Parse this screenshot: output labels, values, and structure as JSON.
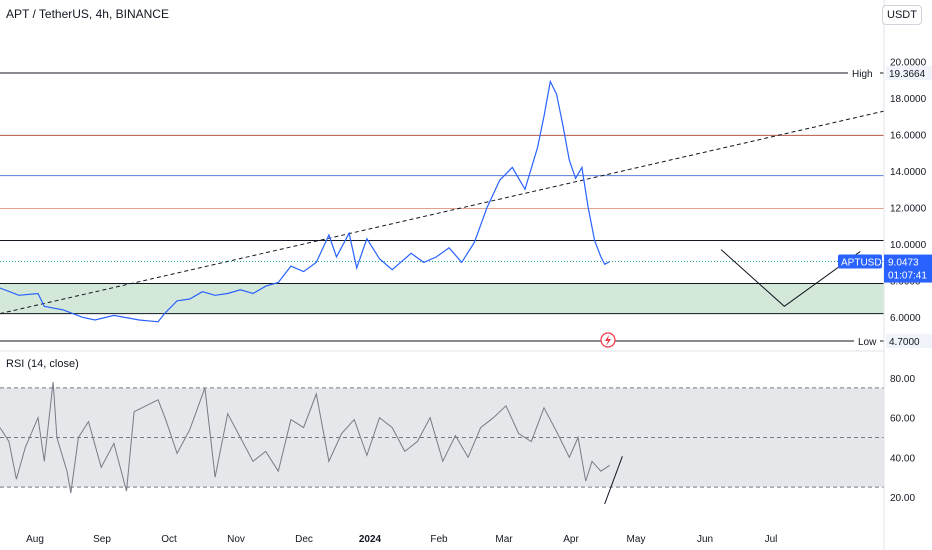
{
  "header": {
    "symbol_title": "APT / TetherUS, 4h, BINANCE",
    "currency_label": "USDT"
  },
  "rsi_header": {
    "label": "RSI (14, close)"
  },
  "colors": {
    "price_line": "#2962ff",
    "rsi_line": "#787b86",
    "support_zone": "#cfe6d6",
    "rsi_band": "#dcdde2",
    "price_tag_bg": "#2962ff",
    "price_line_dotted": "#26a69a"
  },
  "chart_data": [
    {
      "type": "line",
      "title": "APT / TetherUS, 4h, BINANCE",
      "x_ticks": [
        "Aug",
        "Sep",
        "Oct",
        "Nov",
        "Dec",
        "2024",
        "Feb",
        "Mar",
        "Apr",
        "May",
        "Jun",
        "Jul"
      ],
      "y_ticks": [
        "20.0000",
        "18.0000",
        "16.0000",
        "14.0000",
        "12.0000",
        "10.0000",
        "8.0000",
        "6.0000"
      ],
      "ylim": [
        4.4,
        20.6
      ],
      "series": [
        {
          "values": [
            [
              0,
              7.6
            ],
            [
              1.5,
              7.2
            ],
            [
              3,
              7.3
            ],
            [
              3.5,
              6.6
            ],
            [
              5,
              6.4
            ],
            [
              6.5,
              6.0
            ],
            [
              7.5,
              5.85
            ],
            [
              9,
              6.1
            ],
            [
              11,
              5.85
            ],
            [
              12.5,
              5.75
            ],
            [
              13,
              6.2
            ],
            [
              14,
              6.9
            ],
            [
              15,
              7.0
            ],
            [
              16,
              7.4
            ],
            [
              17,
              7.2
            ],
            [
              18,
              7.3
            ],
            [
              19,
              7.5
            ],
            [
              20,
              7.3
            ],
            [
              21,
              7.7
            ],
            [
              22,
              7.9
            ],
            [
              23,
              8.8
            ],
            [
              24,
              8.5
            ],
            [
              25,
              9.0
            ],
            [
              26,
              10.5
            ],
            [
              26.6,
              9.3
            ],
            [
              27.6,
              10.6
            ],
            [
              28.2,
              8.7
            ],
            [
              29,
              10.3
            ],
            [
              30,
              9.2
            ],
            [
              31,
              8.6
            ],
            [
              32.5,
              9.5
            ],
            [
              33.5,
              9.0
            ],
            [
              34.5,
              9.3
            ],
            [
              35.5,
              9.8
            ],
            [
              36.5,
              9.0
            ],
            [
              37.5,
              10.1
            ],
            [
              38.5,
              12.0
            ],
            [
              39.5,
              13.5
            ],
            [
              40.5,
              14.2
            ],
            [
              41.5,
              13.0
            ],
            [
              42.5,
              15.3
            ],
            [
              43,
              17.0
            ],
            [
              43.5,
              18.9
            ],
            [
              44,
              18.2
            ],
            [
              44.5,
              16.5
            ],
            [
              45,
              14.6
            ],
            [
              45.5,
              13.6
            ],
            [
              46,
              14.2
            ],
            [
              46.5,
              12.0
            ],
            [
              47,
              10.2
            ],
            [
              47.5,
              9.3
            ],
            [
              47.8,
              8.9
            ],
            [
              48.2,
              9.0473
            ]
          ]
        }
      ],
      "horizontal_levels": [
        {
          "label": "High",
          "value_label": "19.3664",
          "value": 19.3664
        },
        {
          "value": 15.95
        },
        {
          "value": 13.75
        },
        {
          "value": 11.95
        },
        {
          "value": 10.2
        },
        {
          "value": 7.85
        },
        {
          "value": 6.2
        },
        {
          "label": "Low",
          "value_label": "4.7000",
          "value": 4.7
        }
      ],
      "support_zone": [
        6.2,
        7.85
      ],
      "trendline": {
        "from": [
          0,
          6.2
        ],
        "to": [
          70,
          17.3
        ]
      },
      "projection": [
        [
          57,
          9.7
        ],
        [
          62,
          6.6
        ],
        [
          68,
          9.6
        ]
      ],
      "last_price": {
        "symbol": "APTUSDT",
        "value": 9.0473,
        "value_label": "9.0473",
        "countdown": "01:07:41"
      }
    },
    {
      "type": "line",
      "title": "RSI (14, close)",
      "y_ticks": [
        "80.00",
        "60.00",
        "40.00",
        "20.00"
      ],
      "ylim": [
        15,
        88
      ],
      "band": [
        25,
        75
      ],
      "midline": 50,
      "series": [
        {
          "values": [
            [
              0,
              55
            ],
            [
              0.7,
              48
            ],
            [
              1.3,
              29
            ],
            [
              2,
              45
            ],
            [
              3,
              60
            ],
            [
              3.5,
              38
            ],
            [
              4.2,
              78
            ],
            [
              4.5,
              50
            ],
            [
              5.3,
              33
            ],
            [
              5.6,
              22
            ],
            [
              6.2,
              50
            ],
            [
              7,
              58
            ],
            [
              8,
              35
            ],
            [
              9,
              47
            ],
            [
              10,
              23
            ],
            [
              10.6,
              63
            ],
            [
              12.5,
              69
            ],
            [
              13.1,
              59
            ],
            [
              14,
              42
            ],
            [
              15,
              54
            ],
            [
              16.2,
              75
            ],
            [
              17,
              30
            ],
            [
              18,
              62
            ],
            [
              19,
              50
            ],
            [
              20,
              38
            ],
            [
              21,
              43
            ],
            [
              22,
              33
            ],
            [
              23,
              59
            ],
            [
              24,
              55
            ],
            [
              25,
              72
            ],
            [
              26,
              38
            ],
            [
              27,
              52
            ],
            [
              28,
              59
            ],
            [
              29,
              41
            ],
            [
              30,
              60
            ],
            [
              31,
              55
            ],
            [
              32,
              43
            ],
            [
              33,
              48
            ],
            [
              34,
              60
            ],
            [
              35,
              38
            ],
            [
              36,
              51
            ],
            [
              37,
              40
            ],
            [
              38,
              55
            ],
            [
              39,
              60
            ],
            [
              40,
              66
            ],
            [
              41,
              52
            ],
            [
              42,
              48
            ],
            [
              43,
              65
            ],
            [
              44,
              53
            ],
            [
              45,
              40
            ],
            [
              45.7,
              50
            ],
            [
              46.3,
              28
            ],
            [
              46.8,
              38
            ],
            [
              47.5,
              33
            ],
            [
              48.2,
              36
            ]
          ]
        }
      ],
      "divergence_line": [
        [
          47.8,
          16.5
        ],
        [
          49.2,
          40.5
        ]
      ]
    }
  ]
}
